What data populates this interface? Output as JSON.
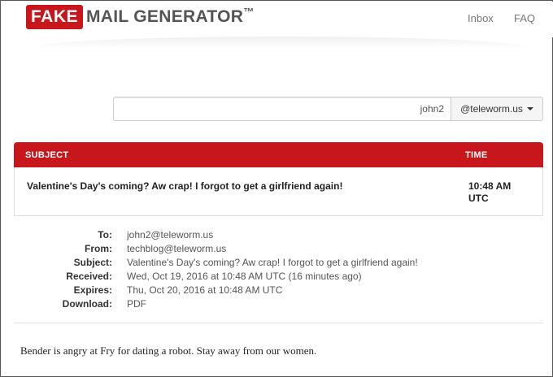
{
  "header": {
    "logo_fake": "FAKE",
    "logo_rest": "MAIL GENERATOR",
    "logo_tm": "™",
    "nav_inbox": "Inbox",
    "nav_faq": "FAQ"
  },
  "search": {
    "username_value": "john2",
    "domain_value": "@teleworm.us"
  },
  "inbox_table": {
    "col_subject": "SUBJECT",
    "col_time": "TIME",
    "rows": [
      {
        "subject": "Valentine's Day's coming? Aw crap! I forgot to get a girlfriend again!",
        "time": "10:48 AM UTC"
      }
    ]
  },
  "message": {
    "to_label": "To:",
    "to": "john2@teleworm.us",
    "from_label": "From:",
    "from": "techblog@teleworm.us",
    "subject_label": "Subject:",
    "subject": "Valentine's Day's coming? Aw crap! I forgot to get a girlfriend again!",
    "received_label": "Received:",
    "received": "Wed, Oct 19, 2016 at 10:48 AM UTC (16 minutes ago)",
    "expires_label": "Expires:",
    "expires": "Thu, Oct 20, 2016 at 10:48 AM UTC",
    "download_label": "Download:",
    "download": "PDF",
    "body": "Bender is angry at Fry for dating a robot. Stay away from our women."
  },
  "colors": {
    "brand_red": "#c8161d",
    "text_dark": "#333333",
    "text_muted": "#777777"
  }
}
